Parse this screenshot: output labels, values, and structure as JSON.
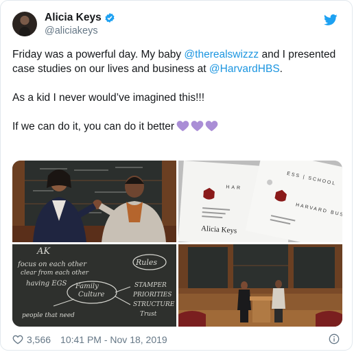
{
  "author": {
    "display_name": "Alicia Keys",
    "handle": "@aliciakeys"
  },
  "tweet": {
    "line1_pre": "Friday was a powerful day. My baby ",
    "mention1": "@therealswizzz",
    "line1_post": " and I presented case studies on our lives and business at ",
    "mention2": "@HarvardHBS",
    "line1_end": ".",
    "line2": "As a kid I never would’ve imagined this!!!",
    "line3": "If we can do it, you can do it better"
  },
  "photos": {
    "photo2_text": {
      "brand_top": "HAR",
      "brand_top_right": "ESS | SCHOOL",
      "name": "Alicia Keys",
      "harvard": "HARVARD",
      "bus": "BUS"
    },
    "photo3_text": {
      "ak": "AK",
      "focus": "focus on each other",
      "clear": "clear from each other",
      "having": "having EGS",
      "family": "Family",
      "culture": "Culture",
      "rules": "Rules",
      "stamp": "STAMPER",
      "priorities": "PRIORITIES",
      "structure": "STRUCTURE",
      "trust": "Trust",
      "what_need": "people that need"
    }
  },
  "footer": {
    "likes": "3,566",
    "timestamp": "10:41 PM - Nov 18, 2019"
  },
  "colors": {
    "link": "#1b95e0",
    "verified": "#1da1f2",
    "heart_emoji": "#aa8ed6",
    "meta": "#657786"
  },
  "icons": {
    "verified": "verified-badge-icon",
    "bird": "twitter-bird-icon",
    "heart": "purple-heart-icon",
    "like": "heart-outline-icon",
    "info": "info-icon"
  }
}
